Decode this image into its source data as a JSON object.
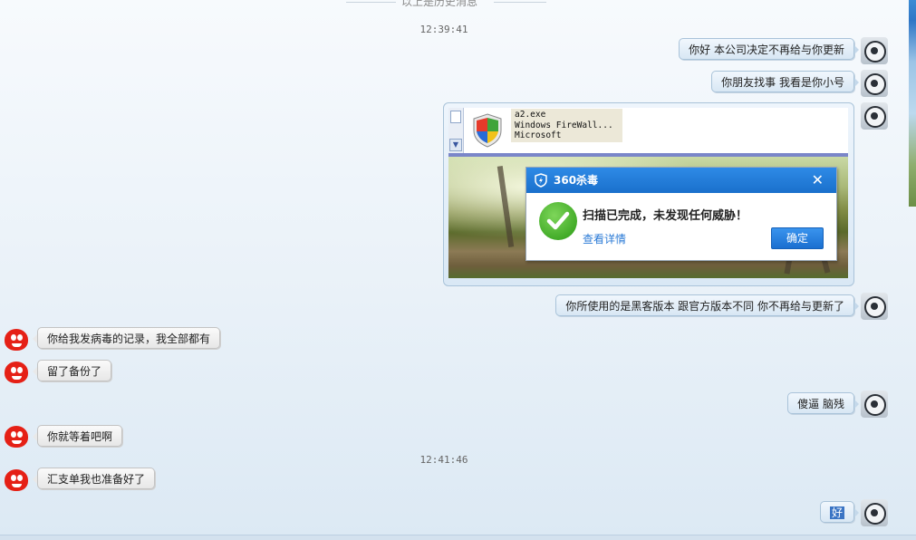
{
  "chat": {
    "history_label": "以上是历史消息",
    "timestamps": [
      "12:39:41",
      "12:41:46"
    ],
    "messages": [
      {
        "side": "right",
        "text": "你好  本公司决定不再给与你更新"
      },
      {
        "side": "right",
        "text": "你朋友找事  我看是你小号"
      },
      {
        "side": "right",
        "text": "你所使用的是黑客版本 跟官方版本不同   你不再给与更新了"
      },
      {
        "side": "left",
        "text": "你给我发病毒的记录，我全部都有"
      },
      {
        "side": "left",
        "text": "留了备份了"
      },
      {
        "side": "right",
        "text": "傻逼 脑残"
      },
      {
        "side": "left",
        "text": "你就等着吧啊"
      },
      {
        "side": "left",
        "text": "汇支单我也准备好了"
      },
      {
        "side": "right",
        "text": "好"
      }
    ]
  },
  "screenshot": {
    "firewall_lines": [
      "a2.exe",
      "Windows FireWall...",
      "Microsoft"
    ],
    "antivirus": {
      "title": "360杀毒",
      "close": "✕",
      "message": "扫描已完成，未发现任何威胁！",
      "details_link": "查看详情",
      "ok_button": "确定"
    }
  },
  "colors": {
    "accent": "#1a70cc",
    "check": "#2a9a14",
    "selection": "#3a74c4"
  }
}
